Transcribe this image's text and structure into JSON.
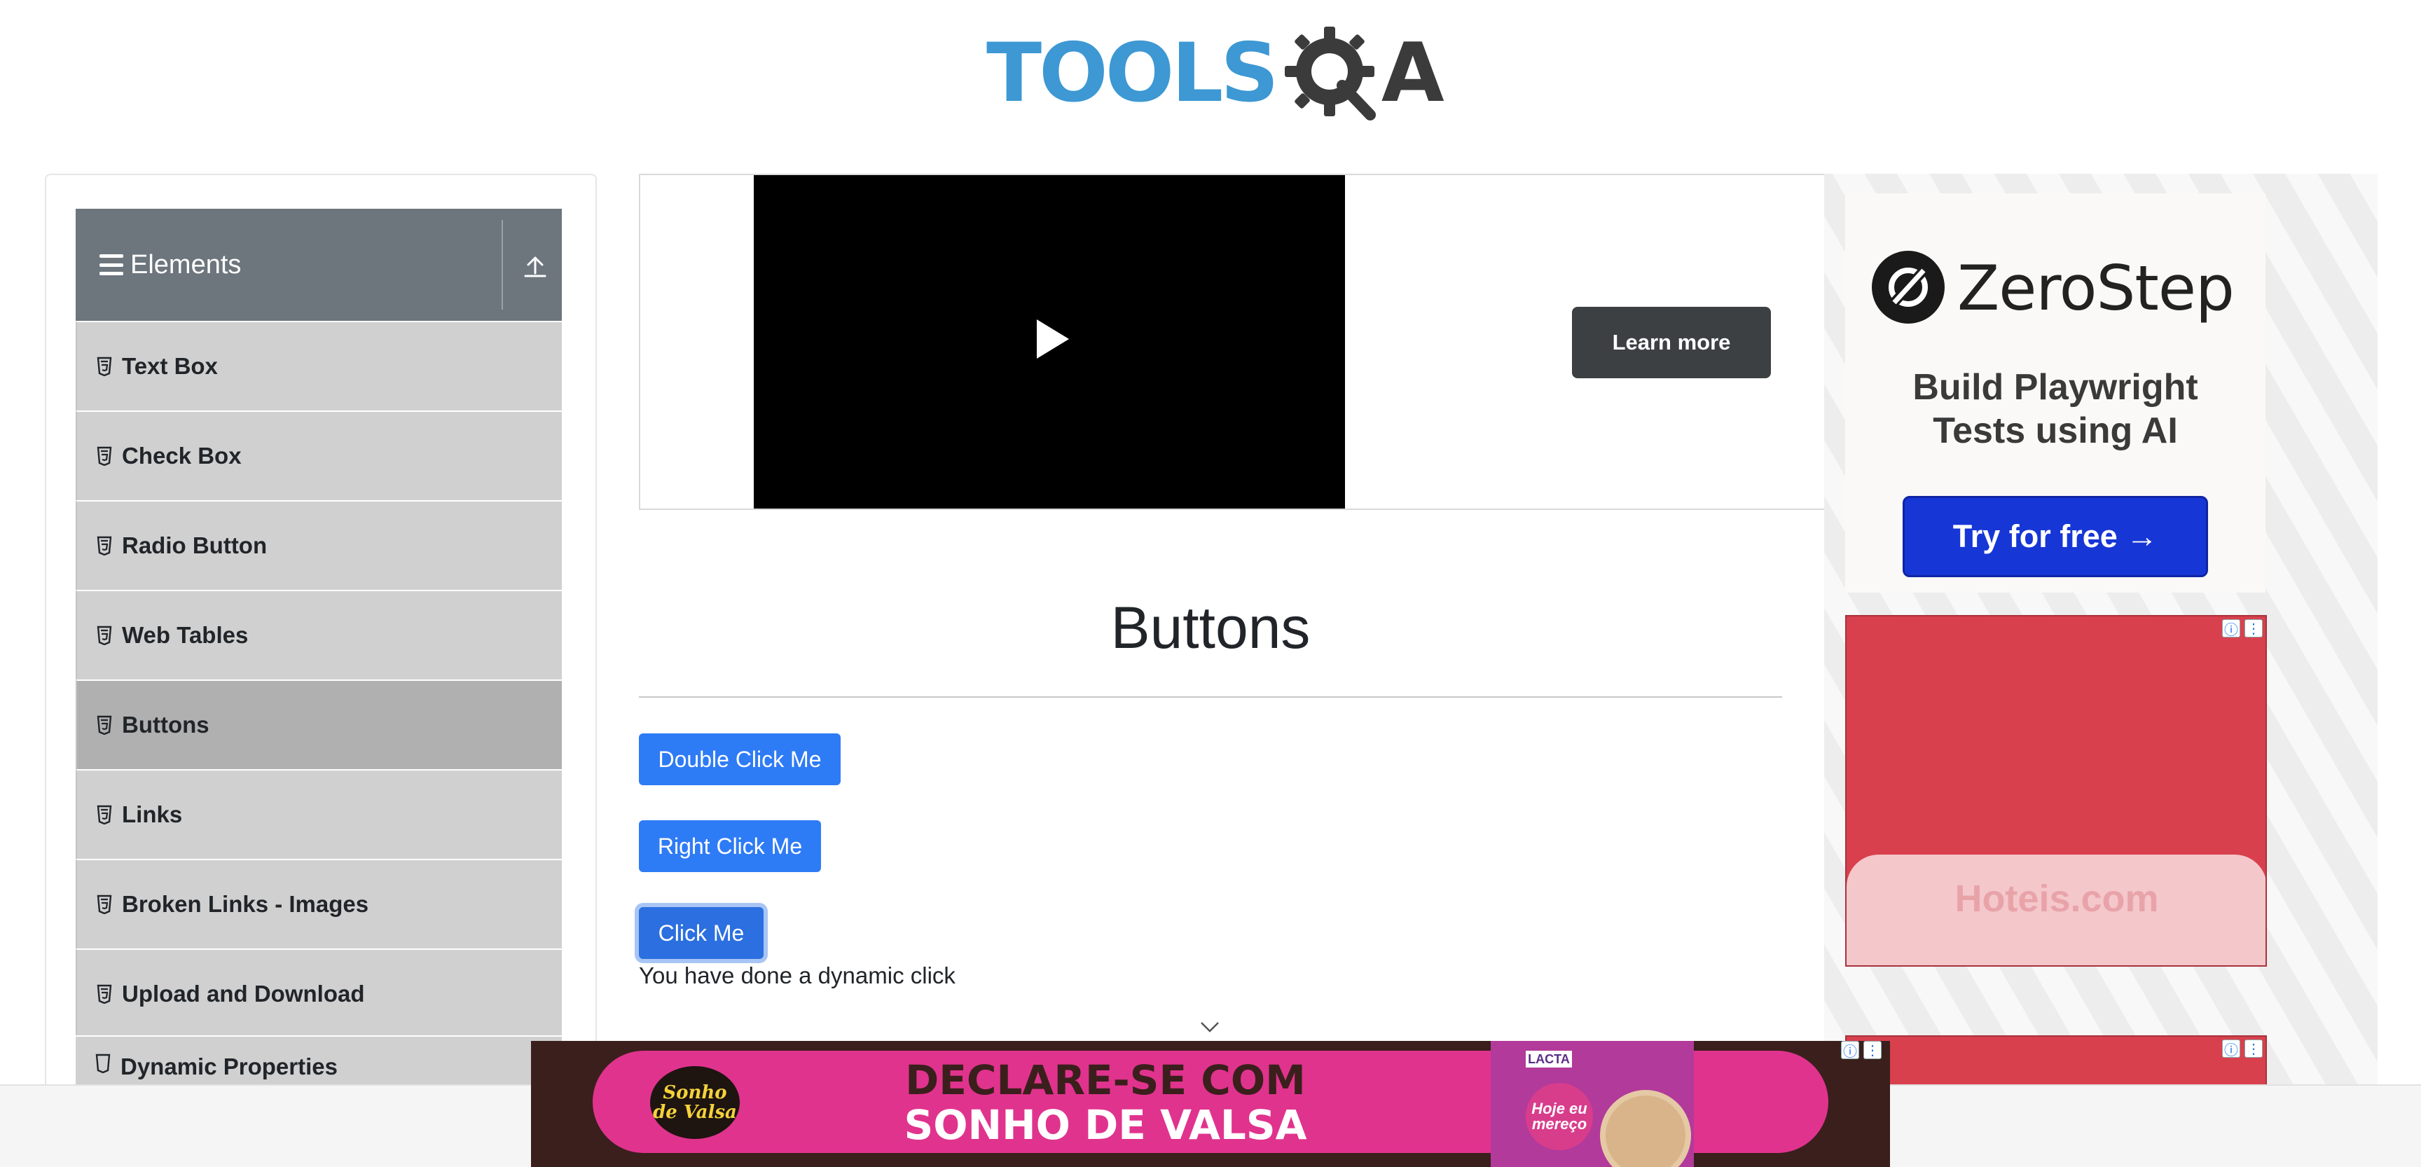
{
  "header": {
    "logo_text": "TOOLSQA",
    "logo_part_1": "TOOLS",
    "logo_part_2": "A"
  },
  "sidebar": {
    "group_title": "Elements",
    "items": [
      {
        "label": "Text Box",
        "active": false
      },
      {
        "label": "Check Box",
        "active": false
      },
      {
        "label": "Radio Button",
        "active": false
      },
      {
        "label": "Web Tables",
        "active": false
      },
      {
        "label": "Buttons",
        "active": true
      },
      {
        "label": "Links",
        "active": false
      },
      {
        "label": "Broken Links - Images",
        "active": false
      },
      {
        "label": "Upload and Download",
        "active": false
      },
      {
        "label": "Dynamic Properties",
        "active": false
      }
    ]
  },
  "video_ad": {
    "cta_label": "Learn more"
  },
  "main": {
    "title": "Buttons",
    "double_click_label": "Double Click Me",
    "right_click_label": "Right Click Me",
    "click_label": "Click Me",
    "dynamic_click_message": "You have done a dynamic click"
  },
  "right_ads": {
    "zerostep": {
      "brand": "ZeroStep",
      "tagline_line1": "Build Playwright",
      "tagline_line2": "Tests using AI",
      "cta": "Try for free →"
    },
    "hoteis": {
      "brand": "Hoteis.com"
    }
  },
  "bottom_banner": {
    "brand": "Sonho de Valsa",
    "headline_line1": "DECLARE-SE COM",
    "headline_line2": "SONHO DE VALSA",
    "product_brand": "LACTA",
    "product_tag": "Hoje eu mereço"
  },
  "colors": {
    "primary_button": "#2e7bf6",
    "sidebar_header": "#6d757d",
    "logo_blue": "#3d98d3",
    "logo_dark": "#3b3b3b"
  },
  "icons": [
    "menu-icon",
    "collapse-up-icon",
    "html5-icon",
    "play-icon",
    "chevron-down-icon",
    "ad-info-icon",
    "ad-menu-icon",
    "zerostep-logo-icon"
  ]
}
